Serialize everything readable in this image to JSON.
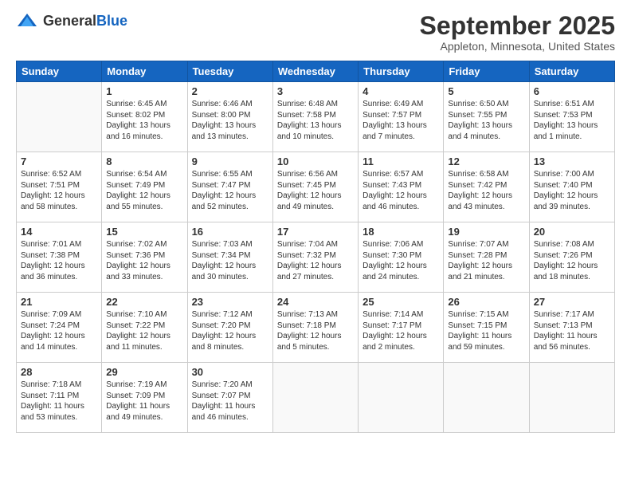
{
  "header": {
    "logo_general": "General",
    "logo_blue": "Blue",
    "month_title": "September 2025",
    "location": "Appleton, Minnesota, United States"
  },
  "days_of_week": [
    "Sunday",
    "Monday",
    "Tuesday",
    "Wednesday",
    "Thursday",
    "Friday",
    "Saturday"
  ],
  "weeks": [
    [
      {
        "date": "",
        "sunrise": "",
        "sunset": "",
        "daylight": ""
      },
      {
        "date": "1",
        "sunrise": "Sunrise: 6:45 AM",
        "sunset": "Sunset: 8:02 PM",
        "daylight": "Daylight: 13 hours and 16 minutes."
      },
      {
        "date": "2",
        "sunrise": "Sunrise: 6:46 AM",
        "sunset": "Sunset: 8:00 PM",
        "daylight": "Daylight: 13 hours and 13 minutes."
      },
      {
        "date": "3",
        "sunrise": "Sunrise: 6:48 AM",
        "sunset": "Sunset: 7:58 PM",
        "daylight": "Daylight: 13 hours and 10 minutes."
      },
      {
        "date": "4",
        "sunrise": "Sunrise: 6:49 AM",
        "sunset": "Sunset: 7:57 PM",
        "daylight": "Daylight: 13 hours and 7 minutes."
      },
      {
        "date": "5",
        "sunrise": "Sunrise: 6:50 AM",
        "sunset": "Sunset: 7:55 PM",
        "daylight": "Daylight: 13 hours and 4 minutes."
      },
      {
        "date": "6",
        "sunrise": "Sunrise: 6:51 AM",
        "sunset": "Sunset: 7:53 PM",
        "daylight": "Daylight: 13 hours and 1 minute."
      }
    ],
    [
      {
        "date": "7",
        "sunrise": "Sunrise: 6:52 AM",
        "sunset": "Sunset: 7:51 PM",
        "daylight": "Daylight: 12 hours and 58 minutes."
      },
      {
        "date": "8",
        "sunrise": "Sunrise: 6:54 AM",
        "sunset": "Sunset: 7:49 PM",
        "daylight": "Daylight: 12 hours and 55 minutes."
      },
      {
        "date": "9",
        "sunrise": "Sunrise: 6:55 AM",
        "sunset": "Sunset: 7:47 PM",
        "daylight": "Daylight: 12 hours and 52 minutes."
      },
      {
        "date": "10",
        "sunrise": "Sunrise: 6:56 AM",
        "sunset": "Sunset: 7:45 PM",
        "daylight": "Daylight: 12 hours and 49 minutes."
      },
      {
        "date": "11",
        "sunrise": "Sunrise: 6:57 AM",
        "sunset": "Sunset: 7:43 PM",
        "daylight": "Daylight: 12 hours and 46 minutes."
      },
      {
        "date": "12",
        "sunrise": "Sunrise: 6:58 AM",
        "sunset": "Sunset: 7:42 PM",
        "daylight": "Daylight: 12 hours and 43 minutes."
      },
      {
        "date": "13",
        "sunrise": "Sunrise: 7:00 AM",
        "sunset": "Sunset: 7:40 PM",
        "daylight": "Daylight: 12 hours and 39 minutes."
      }
    ],
    [
      {
        "date": "14",
        "sunrise": "Sunrise: 7:01 AM",
        "sunset": "Sunset: 7:38 PM",
        "daylight": "Daylight: 12 hours and 36 minutes."
      },
      {
        "date": "15",
        "sunrise": "Sunrise: 7:02 AM",
        "sunset": "Sunset: 7:36 PM",
        "daylight": "Daylight: 12 hours and 33 minutes."
      },
      {
        "date": "16",
        "sunrise": "Sunrise: 7:03 AM",
        "sunset": "Sunset: 7:34 PM",
        "daylight": "Daylight: 12 hours and 30 minutes."
      },
      {
        "date": "17",
        "sunrise": "Sunrise: 7:04 AM",
        "sunset": "Sunset: 7:32 PM",
        "daylight": "Daylight: 12 hours and 27 minutes."
      },
      {
        "date": "18",
        "sunrise": "Sunrise: 7:06 AM",
        "sunset": "Sunset: 7:30 PM",
        "daylight": "Daylight: 12 hours and 24 minutes."
      },
      {
        "date": "19",
        "sunrise": "Sunrise: 7:07 AM",
        "sunset": "Sunset: 7:28 PM",
        "daylight": "Daylight: 12 hours and 21 minutes."
      },
      {
        "date": "20",
        "sunrise": "Sunrise: 7:08 AM",
        "sunset": "Sunset: 7:26 PM",
        "daylight": "Daylight: 12 hours and 18 minutes."
      }
    ],
    [
      {
        "date": "21",
        "sunrise": "Sunrise: 7:09 AM",
        "sunset": "Sunset: 7:24 PM",
        "daylight": "Daylight: 12 hours and 14 minutes."
      },
      {
        "date": "22",
        "sunrise": "Sunrise: 7:10 AM",
        "sunset": "Sunset: 7:22 PM",
        "daylight": "Daylight: 12 hours and 11 minutes."
      },
      {
        "date": "23",
        "sunrise": "Sunrise: 7:12 AM",
        "sunset": "Sunset: 7:20 PM",
        "daylight": "Daylight: 12 hours and 8 minutes."
      },
      {
        "date": "24",
        "sunrise": "Sunrise: 7:13 AM",
        "sunset": "Sunset: 7:18 PM",
        "daylight": "Daylight: 12 hours and 5 minutes."
      },
      {
        "date": "25",
        "sunrise": "Sunrise: 7:14 AM",
        "sunset": "Sunset: 7:17 PM",
        "daylight": "Daylight: 12 hours and 2 minutes."
      },
      {
        "date": "26",
        "sunrise": "Sunrise: 7:15 AM",
        "sunset": "Sunset: 7:15 PM",
        "daylight": "Daylight: 11 hours and 59 minutes."
      },
      {
        "date": "27",
        "sunrise": "Sunrise: 7:17 AM",
        "sunset": "Sunset: 7:13 PM",
        "daylight": "Daylight: 11 hours and 56 minutes."
      }
    ],
    [
      {
        "date": "28",
        "sunrise": "Sunrise: 7:18 AM",
        "sunset": "Sunset: 7:11 PM",
        "daylight": "Daylight: 11 hours and 53 minutes."
      },
      {
        "date": "29",
        "sunrise": "Sunrise: 7:19 AM",
        "sunset": "Sunset: 7:09 PM",
        "daylight": "Daylight: 11 hours and 49 minutes."
      },
      {
        "date": "30",
        "sunrise": "Sunrise: 7:20 AM",
        "sunset": "Sunset: 7:07 PM",
        "daylight": "Daylight: 11 hours and 46 minutes."
      },
      {
        "date": "",
        "sunrise": "",
        "sunset": "",
        "daylight": ""
      },
      {
        "date": "",
        "sunrise": "",
        "sunset": "",
        "daylight": ""
      },
      {
        "date": "",
        "sunrise": "",
        "sunset": "",
        "daylight": ""
      },
      {
        "date": "",
        "sunrise": "",
        "sunset": "",
        "daylight": ""
      }
    ]
  ]
}
